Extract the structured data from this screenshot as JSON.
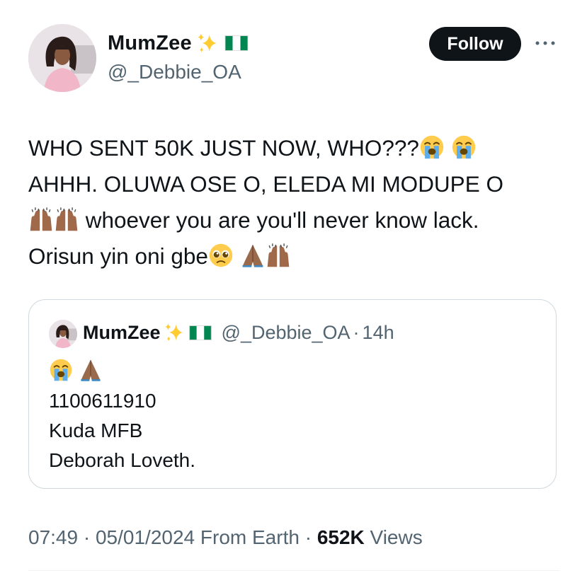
{
  "author": {
    "display_name": "MumZee",
    "handle": "@_Debbie_OA",
    "badges": [
      "sparkles-icon",
      "nigeria-flag-icon"
    ]
  },
  "follow_label": "Follow",
  "tweet": {
    "lines": [
      {
        "text": "WHO SENT 50K JUST NOW, WHO???",
        "emoji_after": [
          "loudly-crying-face-icon",
          "loudly-crying-face-icon"
        ]
      },
      {
        "text": "AHHH. OLUWA OSE O, ELEDA MI MODUPE O"
      },
      {
        "emoji_before": [
          "raising-hands-icon",
          "raising-hands-icon"
        ],
        "text": " whoever you are you'll never know lack."
      },
      {
        "text": "Orisun yin oni gbe",
        "emoji_after": [
          "pleading-face-icon",
          "folded-hands-icon",
          "raising-hands-icon"
        ]
      }
    ],
    "line1": "WHO SENT 50K JUST NOW, WHO???",
    "line2": "AHHH. OLUWA OSE O, ELEDA MI MODUPE O",
    "line3": " whoever you are you'll never know lack.",
    "line4": "Orisun yin oni gbe"
  },
  "quoted": {
    "display_name": "MumZee",
    "handle": "@_Debbie_OA",
    "separator": " · ",
    "time": "14h",
    "emoji_line": [
      "loudly-crying-face-icon",
      "folded-hands-icon"
    ],
    "account_number": "1100611910",
    "bank": "Kuda MFB",
    "account_name": "Deborah Loveth."
  },
  "meta": {
    "time": "07:49",
    "sep": " · ",
    "date": "05/01/2024",
    "source": " From Earth",
    "views_count": "652K",
    "views_label": " Views"
  },
  "colors": {
    "text": "#0f1419",
    "secondary": "#536471",
    "border": "#cfd9de",
    "button_bg": "#0f1419",
    "flag_green": "#008751"
  }
}
